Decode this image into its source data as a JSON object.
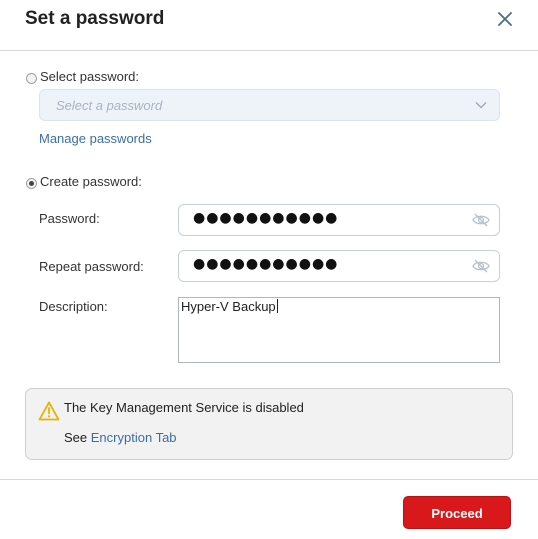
{
  "dialog": {
    "title": "Set a password",
    "close_icon": "close-icon"
  },
  "select_password": {
    "label": "Select password:",
    "selected": false,
    "placeholder": "Select a password",
    "manage_link": "Manage passwords"
  },
  "create_password": {
    "label": "Create password:",
    "selected": true,
    "password_label": "Password:",
    "password_value": "●●●●●●●●●●●",
    "repeat_label": "Repeat password:",
    "repeat_value": "●●●●●●●●●●●",
    "description_label": "Description:",
    "description_value": "Hyper-V Backup"
  },
  "warning": {
    "icon": "warning-icon",
    "message": "The Key Management Service is disabled",
    "see_prefix": "See",
    "link": "Encryption Tab"
  },
  "footer": {
    "proceed_label": "Proceed"
  },
  "colors": {
    "accent_red": "#d9181b",
    "link_blue": "#3a6ea8",
    "warning_yellow": "#e8b400"
  }
}
